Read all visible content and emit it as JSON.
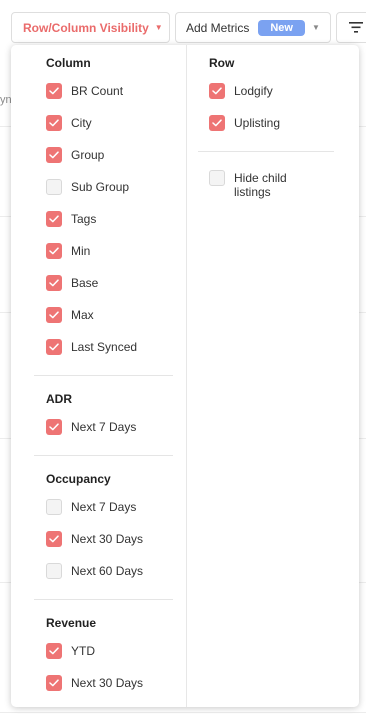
{
  "toolbar": {
    "visibility_label": "Row/Column Visibility",
    "metrics_label": "Add Metrics",
    "new_badge": "New"
  },
  "background": {
    "fragment": "yn"
  },
  "dropdown": {
    "column_section": {
      "title": "Column",
      "options": [
        {
          "label": "BR Count",
          "checked": true
        },
        {
          "label": "City",
          "checked": true
        },
        {
          "label": "Group",
          "checked": true
        },
        {
          "label": "Sub Group",
          "checked": false
        },
        {
          "label": "Tags",
          "checked": true
        },
        {
          "label": "Min",
          "checked": true
        },
        {
          "label": "Base",
          "checked": true
        },
        {
          "label": "Max",
          "checked": true
        },
        {
          "label": "Last Synced",
          "checked": true
        }
      ]
    },
    "adr_section": {
      "title": "ADR",
      "options": [
        {
          "label": "Next 7 Days",
          "checked": true
        }
      ]
    },
    "occupancy_section": {
      "title": "Occupancy",
      "options": [
        {
          "label": "Next 7 Days",
          "checked": false
        },
        {
          "label": "Next 30 Days",
          "checked": true
        },
        {
          "label": "Next 60 Days",
          "checked": false
        }
      ]
    },
    "revenue_section": {
      "title": "Revenue",
      "options": [
        {
          "label": "YTD",
          "checked": true
        },
        {
          "label": "Next 30 Days",
          "checked": true
        }
      ]
    },
    "row_section": {
      "title": "Row",
      "options": [
        {
          "label": "Lodgify",
          "checked": true
        },
        {
          "label": "Uplisting",
          "checked": true
        }
      ]
    },
    "hide_child": {
      "label": "Hide child listings",
      "checked": false
    }
  },
  "colors": {
    "accent": "#ea6b6b",
    "checkbox_checked": "#ee7474",
    "badge_blue": "#7ba2f1"
  }
}
